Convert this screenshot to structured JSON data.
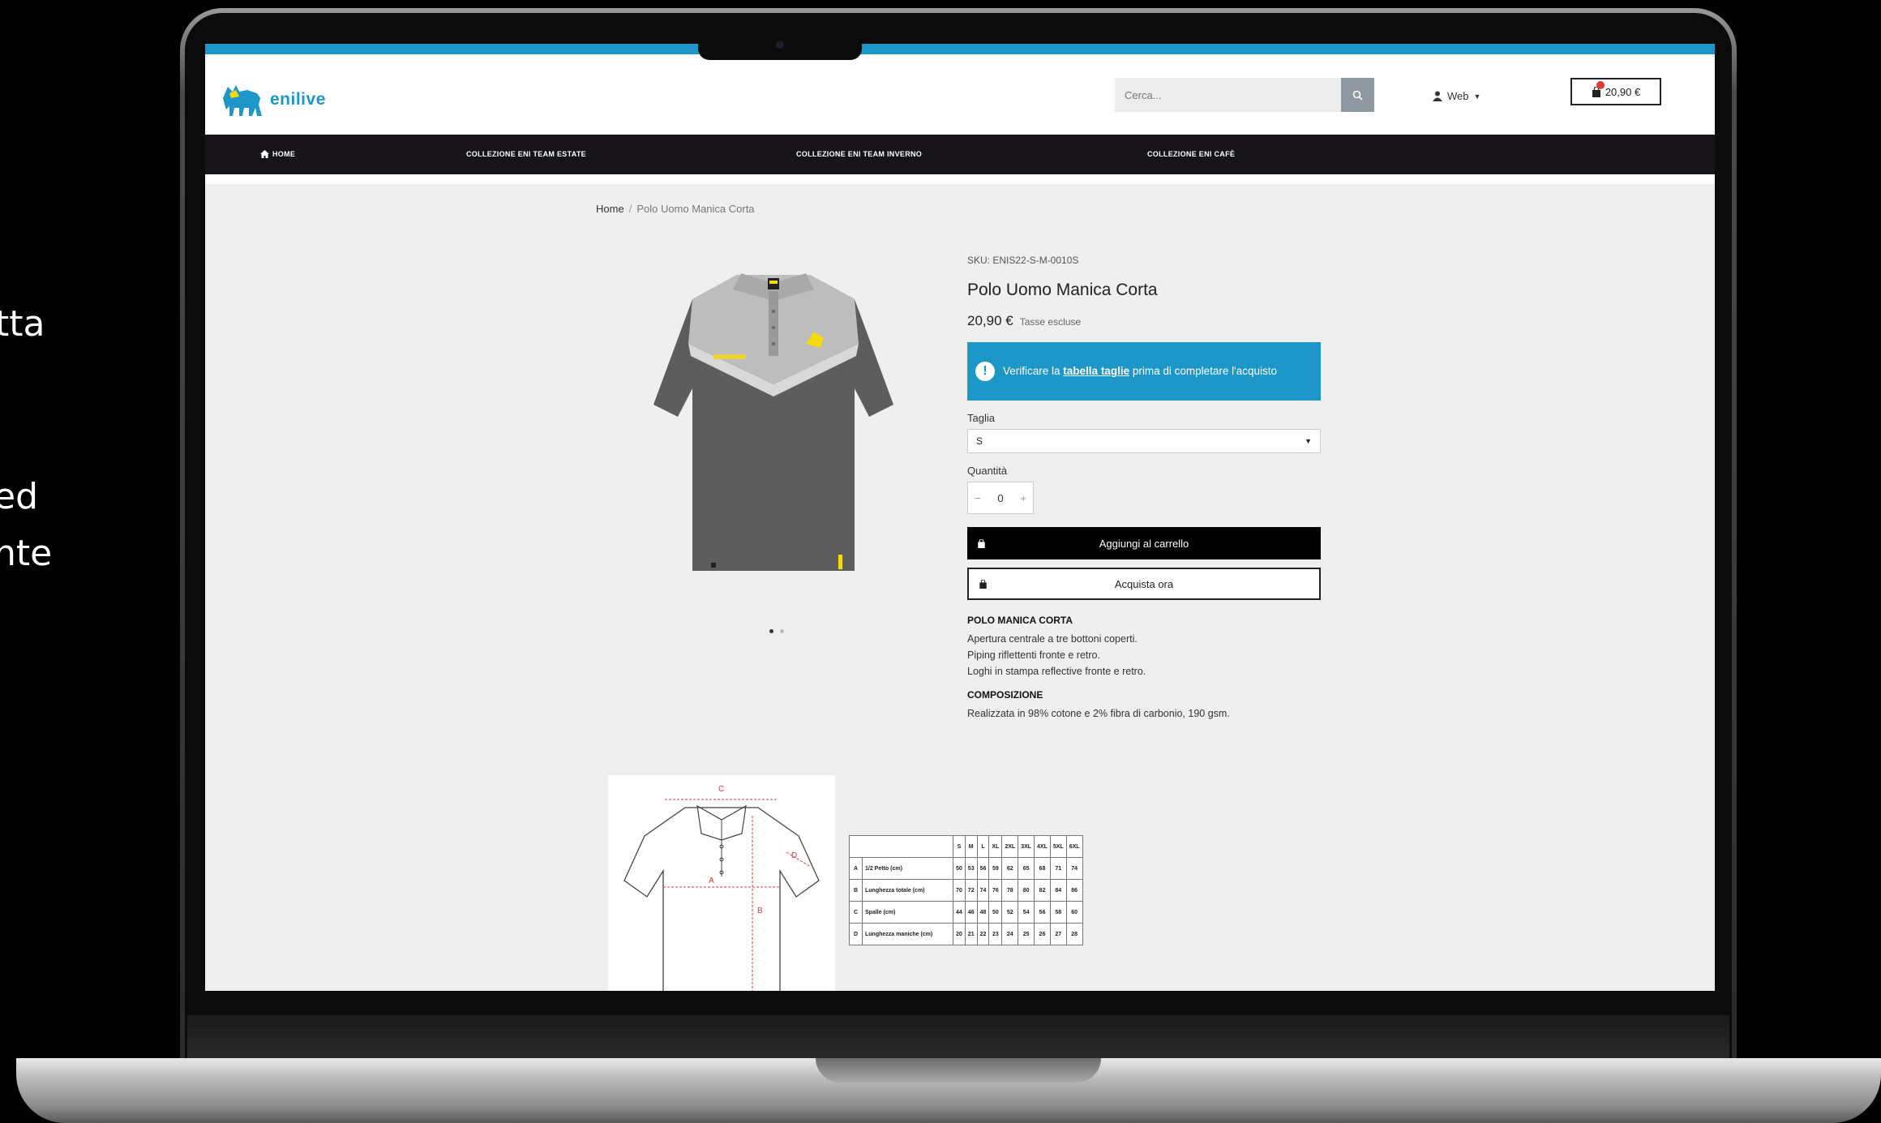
{
  "side_text": {
    "line1": "tta",
    "line2": "ed",
    "line3": "nte"
  },
  "brand": {
    "name": "enilive",
    "accent": "#1c97c7",
    "yellow": "#f5d90a",
    "nav_bg": "#161419"
  },
  "header": {
    "search_placeholder": "Cerca...",
    "user_label": "Web",
    "cart_total": "20,90 €"
  },
  "nav": {
    "items": [
      {
        "label": "HOME",
        "icon": "home-icon"
      },
      {
        "label": "COLLEZIONE ENI TEAM ESTATE"
      },
      {
        "label": "COLLEZIONE ENI TEAM INVERNO"
      },
      {
        "label": "COLLEZIONE ENI CAFÈ"
      }
    ]
  },
  "breadcrumb": {
    "home": "Home",
    "sep": "/",
    "current": "Polo Uomo Manica Corta"
  },
  "product": {
    "sku": "SKU: ENIS22-S-M-0010S",
    "title": "Polo Uomo Manica Corta",
    "price": "20,90 €",
    "tax_note": "Tasse escluse",
    "alert": {
      "pre": "Verificare la ",
      "link": "tabella taglie",
      "post": " prima di completare l'acquisto"
    },
    "size_label": "Taglia",
    "size_value": "S",
    "qty_label": "Quantità",
    "qty_minus": "−",
    "qty_value": "0",
    "qty_plus": "+",
    "add_to_cart": "Aggiungi al carrello",
    "buy_now": "Acquista ora",
    "desc_title": "POLO MANICA CORTA",
    "desc_lines": [
      "Apertura centrale a tre bottoni coperti.",
      "Piping riflettenti fronte e retro.",
      "Loghi in stampa reflective fronte e retro."
    ],
    "comp_title": "COMPOSIZIONE",
    "comp_text": "Realizzata in 98% cotone e 2% fibra di carbonio, 190 gsm."
  },
  "size_chart_labels": {
    "a": "A",
    "b": "B",
    "c": "C",
    "d": "D"
  },
  "size_table": {
    "headers": [
      "S",
      "M",
      "L",
      "XL",
      "2XL",
      "3XL",
      "4XL",
      "5XL",
      "6XL"
    ],
    "rows": [
      {
        "key": "A",
        "label": "1/2 Petto (cm)",
        "values": [
          "50",
          "53",
          "56",
          "59",
          "62",
          "65",
          "68",
          "71",
          "74"
        ]
      },
      {
        "key": "B",
        "label": "Lunghezza totale (cm)",
        "values": [
          "70",
          "72",
          "74",
          "76",
          "78",
          "80",
          "82",
          "84",
          "86"
        ]
      },
      {
        "key": "C",
        "label": "Spalle (cm)",
        "values": [
          "44",
          "46",
          "48",
          "50",
          "52",
          "54",
          "56",
          "58",
          "60"
        ]
      },
      {
        "key": "D",
        "label": "Lunghezza maniche (cm)",
        "values": [
          "20",
          "21",
          "22",
          "23",
          "24",
          "25",
          "26",
          "27",
          "28"
        ]
      }
    ]
  }
}
